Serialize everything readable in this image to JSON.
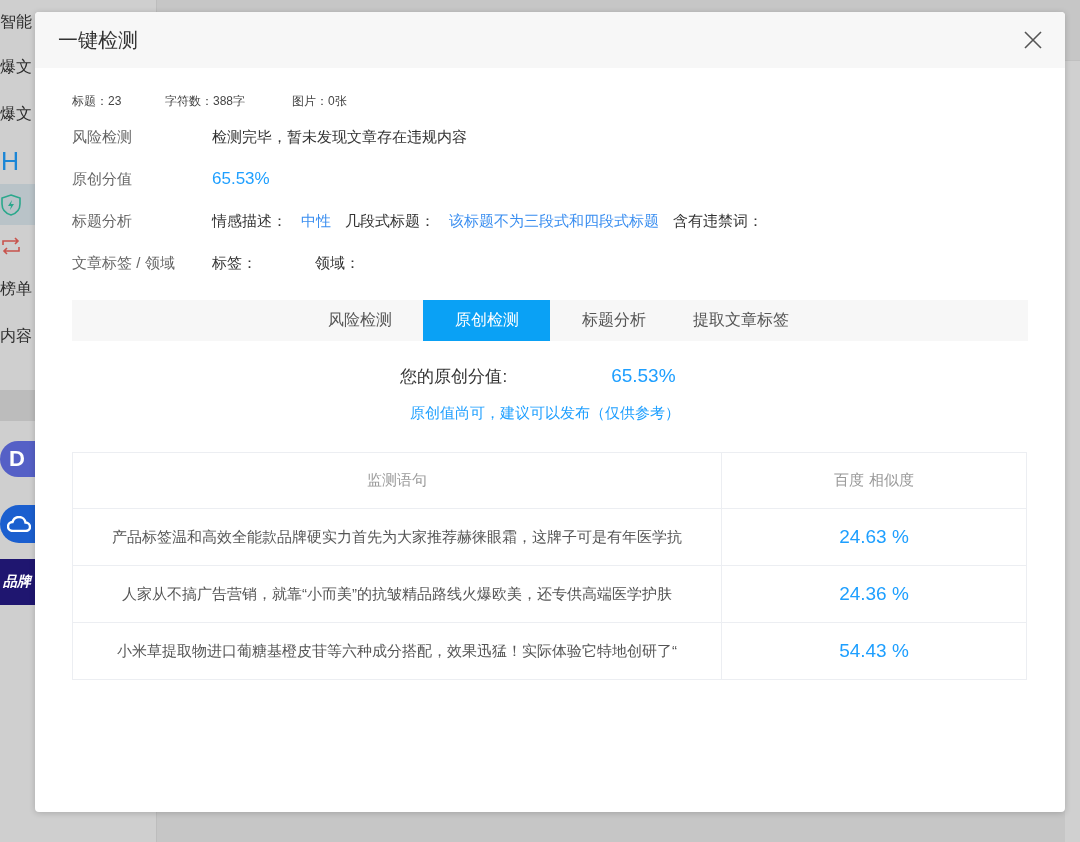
{
  "page": {
    "sidebar": {
      "items": [
        {
          "kind": "text",
          "label": "智能",
          "selected": false
        },
        {
          "kind": "text",
          "label": "爆文",
          "selected": false
        },
        {
          "kind": "text",
          "label": "爆文",
          "selected": false
        },
        {
          "kind": "letter",
          "label": "H",
          "selected": false
        },
        {
          "kind": "shield",
          "selected": true
        },
        {
          "kind": "arrows",
          "selected": false
        },
        {
          "kind": "text",
          "label": "榜单",
          "selected": false
        },
        {
          "kind": "text",
          "label": "内容",
          "selected": false
        }
      ],
      "promos": [
        {
          "kind": "letter",
          "label": "D"
        },
        {
          "kind": "cloud"
        },
        {
          "kind": "text",
          "label": "品牌"
        }
      ]
    }
  },
  "dialog": {
    "title": "一键检测",
    "stats": [
      "标题：23",
      "字符数：388字",
      "图片：0张"
    ],
    "summary": [
      {
        "label": "风险检测",
        "kind": "text",
        "text": "检测完毕，暂未发现文章存在违规内容"
      },
      {
        "label": "原创分值",
        "kind": "score",
        "text": "65.53%"
      },
      {
        "label": "标题分析",
        "kind": "pairs",
        "pairs": [
          {
            "key": "情感描述：",
            "value": "中性"
          },
          {
            "key": "几段式标题：",
            "value": "该标题不为三段式和四段式标题"
          },
          {
            "key": "含有违禁词："
          }
        ]
      },
      {
        "label": "文章标签 / 领域",
        "kind": "pairs",
        "pairs": [
          {
            "key": "标签："
          },
          {
            "key": "领域："
          }
        ]
      }
    ],
    "tabs": [
      {
        "label": "风险检测",
        "selected": false
      },
      {
        "label": "原创检测",
        "selected": true
      },
      {
        "label": "标题分析",
        "selected": false
      },
      {
        "label": "提取文章标签",
        "selected": false
      }
    ],
    "result": {
      "score_label": "您的原创分值:",
      "score": "65.53%",
      "advice": "原创值尚可，建议可以发布（仅供参考）"
    },
    "table": {
      "columns": [
        "监测语句",
        "百度 相似度"
      ],
      "rows": [
        {
          "sentence": "产品标签温和高效全能款品牌硬实力首先为大家推荐赫徕眼霜，这牌子可是有年医学抗",
          "similarity": "24.63 %"
        },
        {
          "sentence": "人家从不搞广告营销，就靠“小而美”的抗皱精品路线火爆欧美，还专供高端医学护肤",
          "similarity": "24.36 %"
        },
        {
          "sentence": "小米草提取物进口葡糖基橙皮苷等六种成分搭配，效果迅猛！实际体验它特地创研了“",
          "similarity": "54.43 %"
        }
      ]
    }
  }
}
